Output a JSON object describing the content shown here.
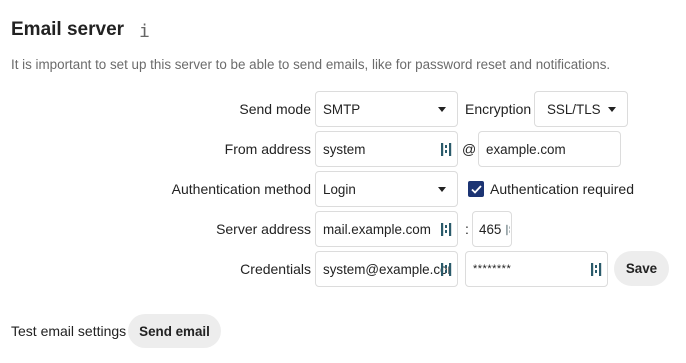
{
  "section": {
    "title": "Email server",
    "info_icon": "i",
    "description": "It is important to set up this server to be able to send emails, like for password reset and notifications."
  },
  "send_mode": {
    "label": "Send mode",
    "value": "SMTP"
  },
  "encryption": {
    "label": "Encryption",
    "value": "SSL/TLS"
  },
  "from_address": {
    "label": "From address",
    "user": "system",
    "at": "@",
    "domain": "example.com"
  },
  "authentication": {
    "label": "Authentication method",
    "method": "Login",
    "required_label": "Authentication required",
    "required_checked": true
  },
  "server": {
    "label": "Server address",
    "host": "mail.example.com",
    "colon": ":",
    "port": "465"
  },
  "credentials": {
    "label": "Credentials",
    "username": "system@example.com",
    "password": "********",
    "save_label": "Save"
  },
  "test": {
    "label": "Test email settings",
    "send_label": "Send email"
  },
  "icons": {
    "password_manager": "password-manager-icon",
    "dropdown": "chevron-down-icon",
    "check": "checkmark-icon"
  },
  "colors": {
    "checkbox": "#1c3473",
    "button_bg": "#ededed",
    "border": "#dcdcdc",
    "description": "#6b6b6b"
  }
}
